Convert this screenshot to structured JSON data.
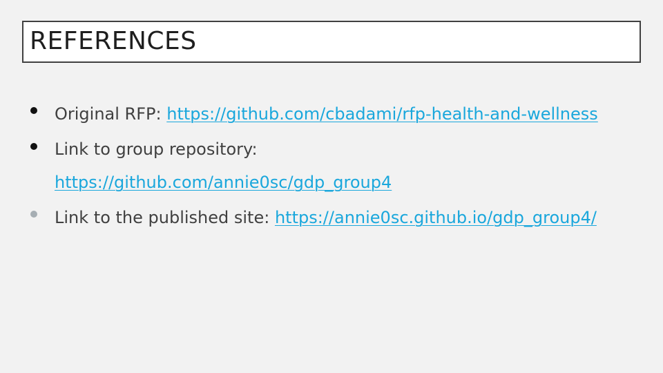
{
  "slide": {
    "title": "REFERENCES",
    "bullets": [
      {
        "label": "Original RFP:",
        "link": "https://github.com/cbadami/rfp-health-and-wellness"
      },
      {
        "label": "Link to group repository:",
        "link": "https://github.com/annie0sc/gdp_group4"
      },
      {
        "label": "Link to the published site:",
        "link": "https://annie0sc.github.io/gdp_group4/"
      }
    ]
  },
  "colors": {
    "background": "#f2f2f2",
    "title_border": "#404040",
    "text": "#404040",
    "link": "#1aa7dc",
    "bullet_dark": "#111111",
    "bullet_light": "#a6aeb3"
  }
}
